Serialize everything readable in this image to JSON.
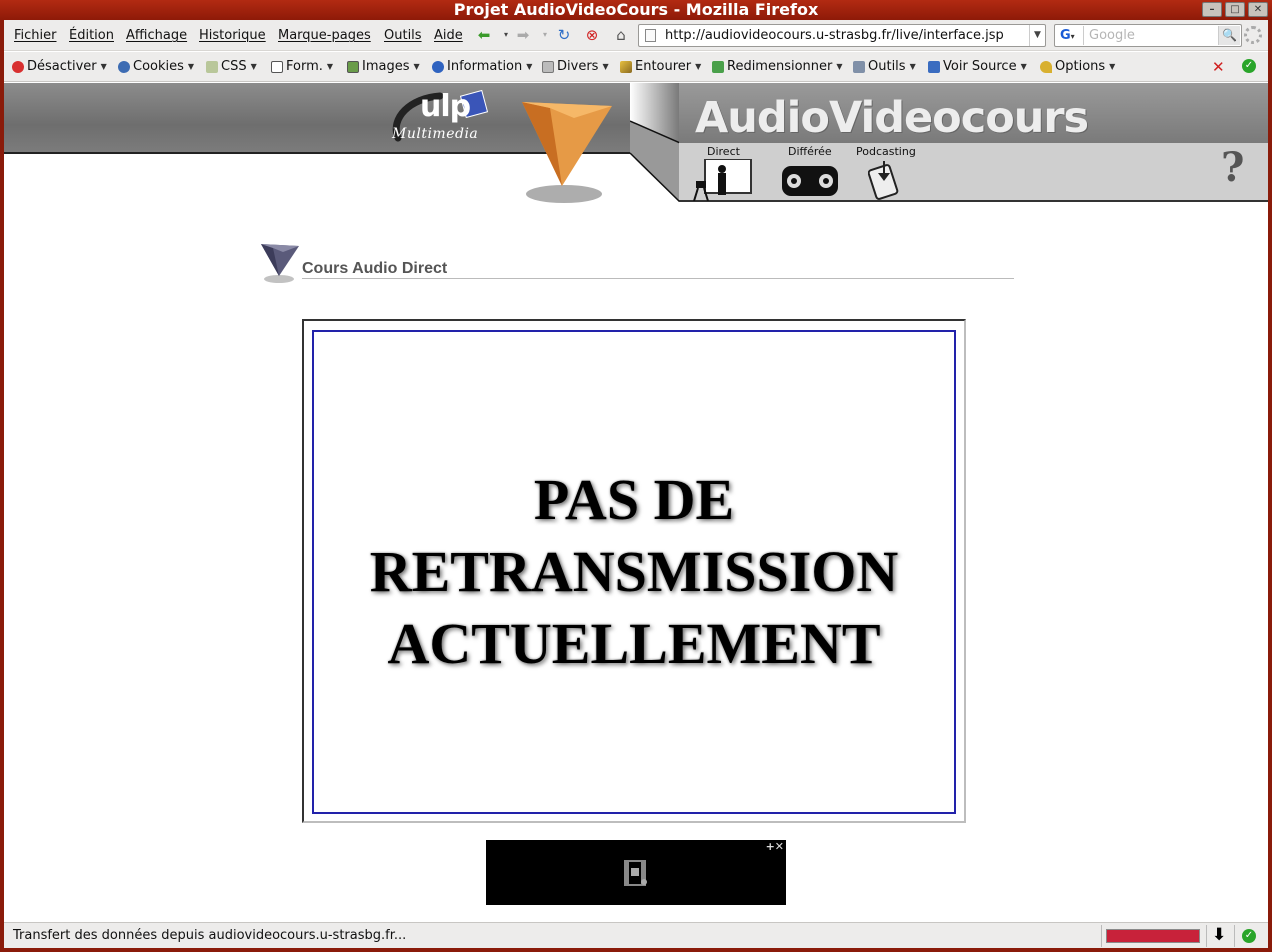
{
  "window": {
    "title": "Projet AudioVideoCours - Mozilla Firefox",
    "controls": [
      "minimize",
      "maximize",
      "close"
    ]
  },
  "menubar": {
    "items": [
      "Fichier",
      "Édition",
      "Affichage",
      "Historique",
      "Marque-pages",
      "Outils",
      "Aide"
    ]
  },
  "navigation": {
    "url": "http://audiovideocours.u-strasbg.fr/live/interface.jsp",
    "search_engine": "G",
    "search_placeholder": "Google"
  },
  "dev_toolbar": {
    "items": [
      "Désactiver",
      "Cookies",
      "CSS",
      "Form.",
      "Images",
      "Information",
      "Divers",
      "Entourer",
      "Redimensionner",
      "Outils",
      "Voir Source",
      "Options"
    ]
  },
  "banner": {
    "ulp_logo": "ulp",
    "ulp_subtitle": "Multimedia",
    "brand": "AudioVideocours",
    "tabs": [
      "Direct",
      "Différée",
      "Podcasting"
    ],
    "help_icon": "?"
  },
  "content": {
    "section_title": "Cours Audio Direct",
    "message_line1": "PAS DE",
    "message_line2": "RETRANSMISSION",
    "message_line3": "ACTUELLEMENT",
    "player_controls": "+✕"
  },
  "statusbar": {
    "text": "Transfert des données depuis audiovideocours.u-strasbg.fr..."
  },
  "colors": {
    "titlebar": "#a22010",
    "stage_border": "#2222aa",
    "progress": "#c8223a"
  }
}
